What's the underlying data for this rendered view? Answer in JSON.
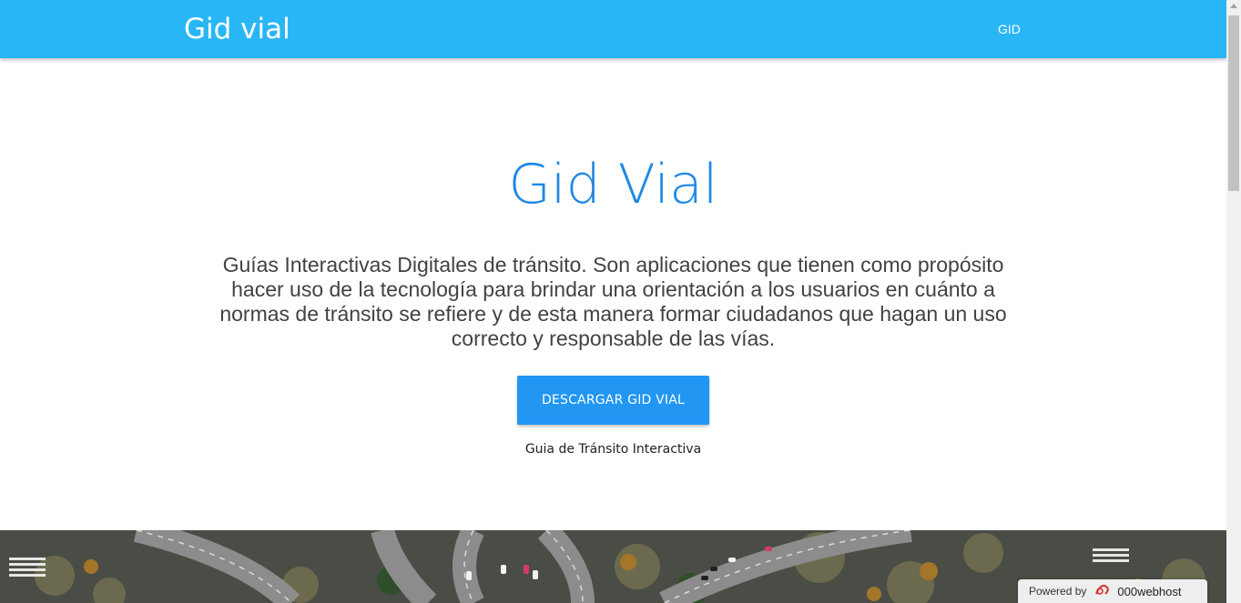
{
  "navbar": {
    "brand": "Gid vial",
    "links": [
      "GID"
    ]
  },
  "hero": {
    "title": "Gid Vial",
    "description": "Guías Interactivas Digitales de tránsito. Son aplicaciones que tienen como propósito hacer uso de la tecnología para brindar una orientación a los usuarios en cuánto a normas de tránsito se refiere y de esta manera formar ciudadanos que hagan un uso correcto y responsable de las vías.",
    "button_label": "DESCARGAR GID VIAL",
    "caption": "Guia de Tránsito Interactiva"
  },
  "badge": {
    "powered_by": "Powered by",
    "host_name": "000webhost",
    "icon": "000webhost-logo-icon"
  },
  "colors": {
    "navbar": "#29b6f6",
    "title": "#1e88e5",
    "button": "#2196f3"
  }
}
